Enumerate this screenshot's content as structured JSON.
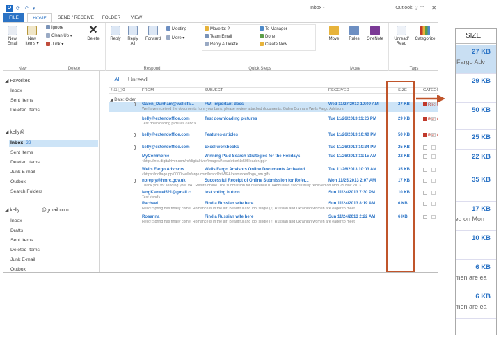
{
  "titlebar": {
    "title": "Inbox - ",
    "app": "Outlook",
    "controls": "?  ▢  ─  ✕",
    "app_icon": "O"
  },
  "tabs": [
    "FILE",
    "HOME",
    "SEND / RECEIVE",
    "FOLDER",
    "VIEW"
  ],
  "ribbon": {
    "new": {
      "new_email": "New Email",
      "new_items": "New Items ▾",
      "label": "New"
    },
    "delete": {
      "ignore": "Ignore",
      "cleanup": "Clean Up ▾",
      "junk": "Junk ▾",
      "delete": "Delete",
      "label": "Delete"
    },
    "respond": {
      "reply": "Reply",
      "reply_all": "Reply All",
      "forward": "Forward",
      "meeting": "Meeting",
      "more": "More ▾",
      "label": "Respond"
    },
    "quicksteps": {
      "items": [
        "Move to: ?",
        "Team Email",
        "Reply & Delete",
        "To Manager",
        "Done",
        "Create New"
      ],
      "label": "Quick Steps"
    },
    "move": {
      "move": "Move",
      "rules": "Rules",
      "onenote": "OneNote",
      "label": "Move"
    },
    "tags": {
      "unread": "Unread/ Read",
      "categorize": "Categorize",
      "label": "Tags"
    }
  },
  "folders": {
    "favorites": {
      "heading": "◢ Favorites",
      "items": [
        "Inbox",
        "Sent Items",
        "Deleted Items"
      ]
    },
    "acct1": {
      "heading": "◢ kelly@",
      "inbox": "Inbox",
      "inbox_count": "22",
      "items": [
        "Sent Items",
        "Deleted Items",
        "Junk E-mail",
        "Outbox",
        "Search Folders"
      ]
    },
    "acct2": {
      "heading": "◢ kelly.",
      "domain": "@gmail.com",
      "items": [
        "Inbox",
        "Drafts",
        "Sent Items",
        "Deleted Items",
        "Junk E-mail",
        "Outbox"
      ]
    }
  },
  "filter": {
    "all": "All",
    "unread": "Unread"
  },
  "columns": {
    "icons": "! ☖ 🗋 0",
    "from": "FROM",
    "subject": "SUBJECT",
    "received": "RECEIVED",
    "size": "SIZE",
    "category": "CATEGORIES"
  },
  "group": "◢ Date: Older",
  "messages": [
    {
      "from": "Galen_Dunham@wellsfa...",
      "subject": "FW: important docs",
      "preview": "We have received the documents from your bank, please review attached documents.  Galen Dunham  Wells Fargo Advisors",
      "date": "Wed 11/27/2013 10:09 AM",
      "size": "27 KB",
      "category": "Red Category"
    },
    {
      "from": "kelly@extendoffice.com",
      "subject": "Test downloading pictures",
      "preview": "Test downloading pictures <end>",
      "date": "Tue 11/26/2013 11:26 PM",
      "size": "29 KB",
      "category": "Red Category"
    },
    {
      "from": "kelly@extendoffice.com",
      "subject": "Features-articles",
      "preview": "",
      "date": "Tue 11/26/2013 10:40 PM",
      "size": "50 KB",
      "category": "Red Category"
    },
    {
      "from": "kelly@extendoffice.com",
      "subject": "Excel-workbooks",
      "preview": "",
      "date": "Tue 11/26/2013 10:34 PM",
      "size": "25 KB",
      "category": ""
    },
    {
      "from": "MyCommerce",
      "subject": "Winning Paid Search Strategies for the Holidays",
      "preview": "<http://info.digitalriver.com/rs/digitalriver/images/NewsletterNo50Header.jpg>",
      "date": "Tue 11/26/2013 11:15 AM",
      "size": "22 KB",
      "category": ""
    },
    {
      "from": "Wells Fargo Advisors",
      "subject": "Wells Fargo Advisors Online Documents Activated",
      "preview": "<https://nolfage.pp.0000.wellsfargo.com/brand/bt/WFA/resources/logo_sm.gif>",
      "date": "Tue 11/26/2013 10:03 AM",
      "size": "35 KB",
      "category": ""
    },
    {
      "from": "noreply@hmrc.gov.uk",
      "subject": "Successful Receipt of Online Submission for Refer...",
      "preview": "Thank you for sending your VAT Return online. The submission for reference 0184880 was successfully received on Mon 25 Nov 2013",
      "date": "Mon 11/25/2013 2:07 AM",
      "size": "17 KB",
      "category": ""
    },
    {
      "from": "langKanwei521@gmail.c...",
      "subject": "test voting button",
      "preview": "Test <end>",
      "date": "Sun 11/24/2013 7:30 PM",
      "size": "10 KB",
      "category": ""
    },
    {
      "from": "Rachael",
      "subject": "Find a Russian wife here",
      "preview": "Hello!  Spring has finally come! Romance is in the air!  Beautiful and idol single (!!) Russian and Ukrainian women are eager to meet",
      "date": "Sun 11/24/2013 8:19 AM",
      "size": "6 KB",
      "category": ""
    },
    {
      "from": "Rosanna",
      "subject": "Find a Russian wife here",
      "preview": "Hello!  Spring has finally come! Romance is in the air!  Beautiful and idol single (!!) Russian and Ukrainian women are eager to meet",
      "date": "Sun 11/24/2013 2:22 AM",
      "size": "6 KB",
      "category": ""
    }
  ],
  "zoom": {
    "header": "SIZE",
    "rows": [
      {
        "size": "27 KB",
        "preview": "s Fargo Adv"
      },
      {
        "size": "29 KB",
        "preview": ""
      },
      {
        "size": "50 KB",
        "preview": ""
      },
      {
        "size": "25 KB",
        "preview": ""
      },
      {
        "size": "22 KB",
        "preview": ""
      },
      {
        "size": "35 KB",
        "preview": ""
      },
      {
        "size": "17 KB",
        "preview": "ved on Mon"
      },
      {
        "size": "10 KB",
        "preview": ""
      },
      {
        "size": "6 KB",
        "preview": "omen are ea"
      },
      {
        "size": "6 KB",
        "preview": "omen are ea"
      }
    ]
  },
  "colors": {
    "accent": "#2b73c5",
    "highlight_box": "#c0552b",
    "selection": "#cde4f7",
    "category_red": "#c0392b"
  }
}
